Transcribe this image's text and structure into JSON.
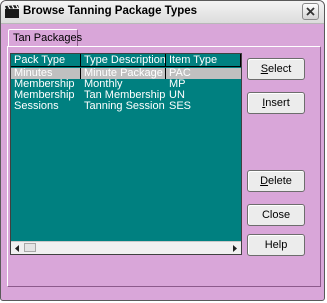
{
  "window": {
    "title": "Browse Tanning Package Types"
  },
  "tabs": [
    {
      "label": "Tan Packages"
    }
  ],
  "grid": {
    "columns": [
      "Pack Type",
      "Type Description",
      "Item Type"
    ],
    "rows": [
      [
        "Minutes",
        "Minute Package",
        "PAC"
      ],
      [
        "Membership",
        "Monthly",
        "MP"
      ],
      [
        "Membership",
        "Tan Membership",
        "UN"
      ],
      [
        "Sessions",
        "Tanning Session",
        "SES"
      ]
    ],
    "selected_row": 0
  },
  "buttons": {
    "select": {
      "label": "Select",
      "mnemonic": "S",
      "rest": "elect"
    },
    "insert": {
      "label": "Insert",
      "mnemonic": "I",
      "rest": "nsert"
    },
    "delete": {
      "label": "Delete",
      "mnemonic": "D",
      "rest": "elete"
    },
    "close": {
      "label": "Close"
    },
    "help": {
      "label": "Help"
    }
  },
  "colors": {
    "window_bg": "#d9a6d9",
    "grid_bg": "#008080",
    "selected_row": "#c0c0c0"
  },
  "icons": {
    "app": "clapperboard-icon",
    "close": "close-x-icon",
    "scroll_left": "arrow-left-icon",
    "scroll_right": "arrow-right-icon"
  }
}
